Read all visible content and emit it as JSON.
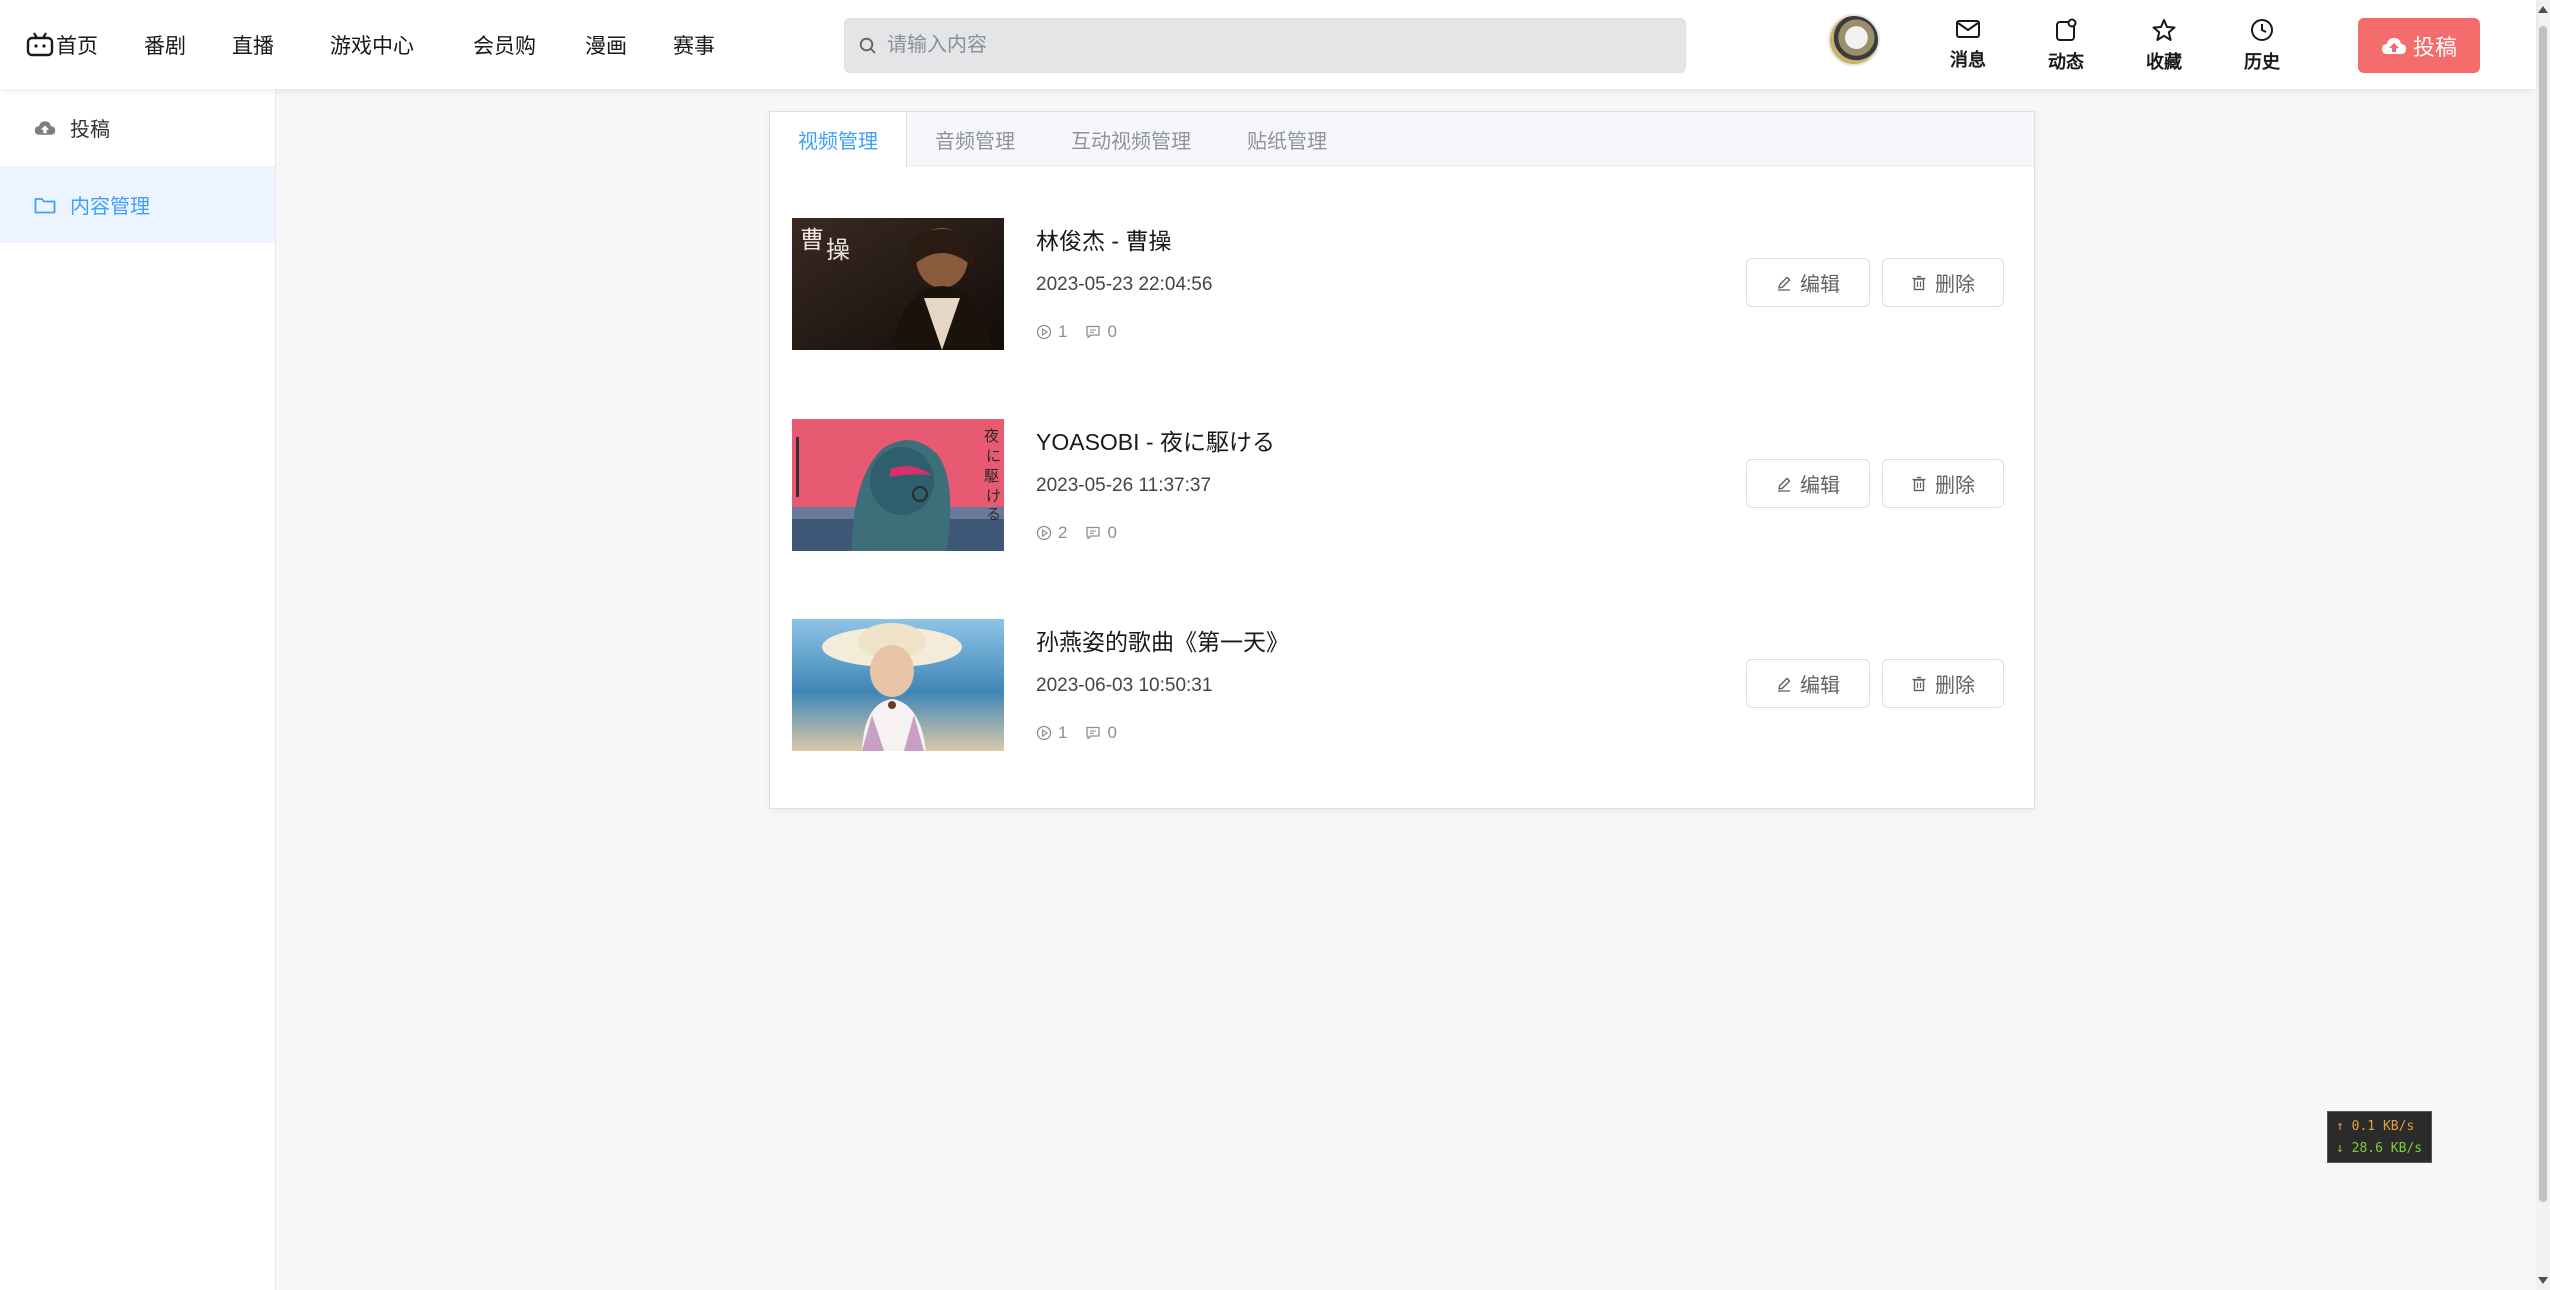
{
  "header": {
    "nav": [
      "首页",
      "番剧",
      "直播",
      "游戏中心",
      "会员购",
      "漫画",
      "赛事"
    ],
    "search_placeholder": "请输入内容",
    "actions": [
      "消息",
      "动态",
      "收藏",
      "历史"
    ],
    "upload_label": "投稿"
  },
  "sidebar": {
    "items": [
      {
        "label": "投稿",
        "icon": "cloud-upload-icon"
      },
      {
        "label": "内容管理",
        "icon": "folder-icon"
      }
    ]
  },
  "main": {
    "tabs": [
      "视频管理",
      "音频管理",
      "互动视频管理",
      "贴纸管理"
    ],
    "active_tab": "视频管理",
    "edit_label": "编辑",
    "delete_label": "删除",
    "videos": [
      {
        "title": "林俊杰 - 曹操",
        "date": "2023-05-23 22:04:56",
        "plays": "1",
        "comments": "0"
      },
      {
        "title": "YOASOBI - 夜に駆ける",
        "date": "2023-05-26 11:37:37",
        "plays": "2",
        "comments": "0"
      },
      {
        "title": "孙燕姿的歌曲《第一天》",
        "date": "2023-06-03 10:50:31",
        "plays": "1",
        "comments": "0"
      }
    ]
  },
  "netspeed": {
    "up": "↑ 0.1 KB/s",
    "down": "↓ 28.6 KB/s"
  },
  "colors": {
    "accent": "#409eff",
    "upload": "#f56c6c",
    "active_bg": "#ecf5ff"
  }
}
